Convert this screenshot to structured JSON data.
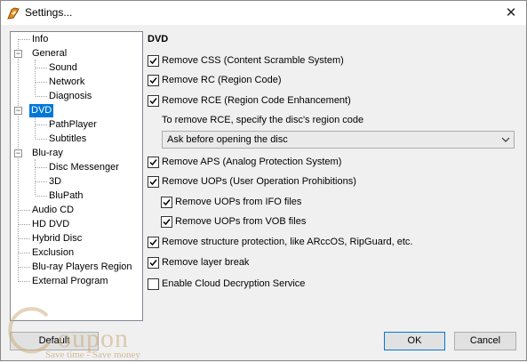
{
  "window": {
    "title": "Settings...",
    "close_glyph": "✕"
  },
  "tree": {
    "items": [
      {
        "label": "Info"
      },
      {
        "label": "General",
        "expander": "−"
      },
      {
        "label": "Sound"
      },
      {
        "label": "Network"
      },
      {
        "label": "Diagnosis"
      },
      {
        "label": "DVD",
        "expander": "−",
        "selected": true
      },
      {
        "label": "PathPlayer"
      },
      {
        "label": "Subtitles"
      },
      {
        "label": "Blu-ray",
        "expander": "−"
      },
      {
        "label": "Disc Messenger"
      },
      {
        "label": "3D"
      },
      {
        "label": "BluPath"
      },
      {
        "label": "Audio CD"
      },
      {
        "label": "HD DVD"
      },
      {
        "label": "Hybrid Disc"
      },
      {
        "label": "Exclusion"
      },
      {
        "label": "Blu-ray Players Region"
      },
      {
        "label": "External Program"
      }
    ]
  },
  "panel": {
    "title": "DVD",
    "options": [
      {
        "label": "Remove CSS (Content Scramble System)",
        "checked": true
      },
      {
        "label": "Remove RC (Region Code)",
        "checked": true
      },
      {
        "label": "Remove RCE (Region Code Enhancement)",
        "checked": true
      },
      {
        "label": "Remove APS (Analog Protection System)",
        "checked": true
      },
      {
        "label": "Remove UOPs (User Operation Prohibitions)",
        "checked": true
      },
      {
        "label": "Remove UOPs from IFO files",
        "checked": true
      },
      {
        "label": "Remove UOPs from VOB files",
        "checked": true
      },
      {
        "label": "Remove structure protection, like ARccOS, RipGuard, etc.",
        "checked": true
      },
      {
        "label": "Remove layer break",
        "checked": true
      },
      {
        "label": "Enable Cloud Decryption Service",
        "checked": false
      }
    ],
    "rce_hint": "To remove RCE, specify the disc's region code",
    "region_select": {
      "value": "Ask before opening the disc"
    }
  },
  "buttons": {
    "default": "Default",
    "ok": "OK",
    "cancel": "Cancel"
  },
  "watermark": {
    "brand": "oupon",
    "tagline": "Save time - Save money"
  }
}
